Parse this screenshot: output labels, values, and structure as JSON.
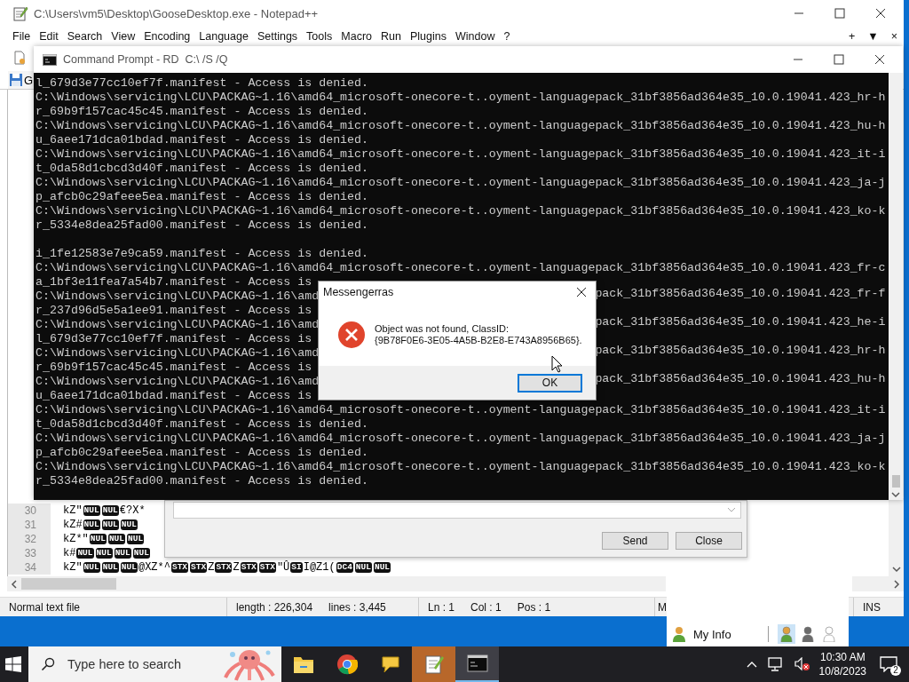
{
  "notepad": {
    "title": "C:\\Users\\vm5\\Desktop\\GooseDesktop.exe - Notepad++",
    "menu": [
      "File",
      "Edit",
      "Search",
      "View",
      "Encoding",
      "Language",
      "Settings",
      "Tools",
      "Macro",
      "Run",
      "Plugins",
      "Window",
      "?"
    ],
    "menu_right": [
      "+",
      "▼",
      "×"
    ],
    "tab": {
      "label": "G"
    },
    "editor": {
      "lines": [
        {
          "number": "30",
          "tokens": [
            {
              "kind": "text",
              "text": "kZ\""
            },
            {
              "kind": "control",
              "text": "NUL"
            },
            {
              "kind": "control",
              "text": "NUL"
            },
            {
              "kind": "text",
              "text": "€?X*"
            }
          ]
        },
        {
          "number": "31",
          "tokens": [
            {
              "kind": "text",
              "text": "kZ#"
            },
            {
              "kind": "control",
              "text": "NUL"
            },
            {
              "kind": "control",
              "text": "NUL"
            },
            {
              "kind": "control",
              "text": "NUL"
            }
          ]
        },
        {
          "number": "32",
          "tokens": [
            {
              "kind": "text",
              "text": "kZ*\""
            },
            {
              "kind": "control",
              "text": "NUL"
            },
            {
              "kind": "control",
              "text": "NUL"
            },
            {
              "kind": "control",
              "text": "NUL"
            }
          ]
        },
        {
          "number": "33",
          "tokens": [
            {
              "kind": "text",
              "text": "k#"
            },
            {
              "kind": "control",
              "text": "NUL"
            },
            {
              "kind": "control",
              "text": "NUL"
            },
            {
              "kind": "control",
              "text": "NUL"
            },
            {
              "kind": "control",
              "text": "NUL"
            }
          ]
        },
        {
          "number": "34",
          "tokens": [
            {
              "kind": "text",
              "text": "kZ\""
            },
            {
              "kind": "control",
              "text": "NUL"
            },
            {
              "kind": "control",
              "text": "NUL"
            },
            {
              "kind": "control",
              "text": "NUL"
            },
            {
              "kind": "text",
              "text": "@XZ*^"
            },
            {
              "kind": "control",
              "text": "STX"
            },
            {
              "kind": "control",
              "text": "STX"
            },
            {
              "kind": "text",
              "text": "Z"
            },
            {
              "kind": "control",
              "text": "STX"
            },
            {
              "kind": "text",
              "text": "Z"
            },
            {
              "kind": "control",
              "text": "STX"
            },
            {
              "kind": "control",
              "text": "STX"
            },
            {
              "kind": "text",
              "text": "\"Û"
            },
            {
              "kind": "control",
              "text": "SI"
            },
            {
              "kind": "text",
              "text": "I@Z1("
            },
            {
              "kind": "control",
              "text": "DC4"
            },
            {
              "kind": "control",
              "text": "NUL"
            },
            {
              "kind": "control",
              "text": "NUL"
            }
          ]
        }
      ]
    },
    "status_bar": [
      {
        "items": [
          "Normal text file"
        ]
      },
      {
        "items": [
          "length : 226,304",
          "lines : 3,445"
        ]
      },
      {
        "items": [
          "Ln : 1",
          "Col : 1",
          "Pos : 1"
        ]
      },
      {
        "items": [
          "M"
        ]
      },
      {
        "items": [
          "INS"
        ]
      }
    ]
  },
  "command_prompt": {
    "title": "Command Prompt - RD  C:\\ /S /Q",
    "lines": [
      {
        "kind": "full",
        "text": "l_679d3e77cc10ef7f.manifest - Access is denied."
      },
      {
        "kind": "full",
        "text": "C:\\Windows\\servicing\\LCU\\PACKAG~1.16\\amd64_microsoft-onecore-t..oyment-languagepack_31bf3856ad364e35_10.0.19041.423_hr-h"
      },
      {
        "kind": "full",
        "text": "r_69b9f157cac45c45.manifest - Access is denied."
      },
      {
        "kind": "full",
        "text": "C:\\Windows\\servicing\\LCU\\PACKAG~1.16\\amd64_microsoft-onecore-t..oyment-languagepack_31bf3856ad364e35_10.0.19041.423_hu-h"
      },
      {
        "kind": "full",
        "text": "u_6aee171dca01bdad.manifest - Access is denied."
      },
      {
        "kind": "full",
        "text": "C:\\Windows\\servicing\\LCU\\PACKAG~1.16\\amd64_microsoft-onecore-t..oyment-languagepack_31bf3856ad364e35_10.0.19041.423_it-i"
      },
      {
        "kind": "full",
        "text": "t_0da58d1cbcd3d40f.manifest - Access is denied."
      },
      {
        "kind": "full",
        "text": "C:\\Windows\\servicing\\LCU\\PACKAG~1.16\\amd64_microsoft-onecore-t..oyment-languagepack_31bf3856ad364e35_10.0.19041.423_ja-j"
      },
      {
        "kind": "full",
        "text": "p_afcb0c29afeee5ea.manifest - Access is denied."
      },
      {
        "kind": "full",
        "text": "C:\\Windows\\servicing\\LCU\\PACKAG~1.16\\amd64_microsoft-onecore-t..oyment-languagepack_31bf3856ad364e35_10.0.19041.423_ko-k"
      },
      {
        "kind": "full",
        "text": "r_5334e8dea25fad00.manifest - Access is denied."
      },
      {
        "kind": "blank"
      },
      {
        "kind": "full",
        "text": "i_1fe12583e7e9ca59.manifest - Access is denied."
      },
      {
        "kind": "full",
        "text": "C:\\Windows\\servicing\\LCU\\PACKAG~1.16\\amd64_microsoft-onecore-t..oyment-languagepack_31bf3856ad364e35_10.0.19041.423_fr-c"
      },
      {
        "kind": "split",
        "left": "a_1bf3e11fea7a54b7.manifest - Access is"
      },
      {
        "kind": "split",
        "left": "C:\\Windows\\servicing\\LCU\\PACKAG~1.16\\amd",
        "right": "pack_31bf3856ad364e35_10.0.19041.423_fr-f"
      },
      {
        "kind": "split",
        "left": "r_237d96d5e5a1ee91.manifest - Access is"
      },
      {
        "kind": "split",
        "left": "C:\\Windows\\servicing\\LCU\\PACKAG~1.16\\amd",
        "right": "pack_31bf3856ad364e35_10.0.19041.423_he-i"
      },
      {
        "kind": "split",
        "left": "l_679d3e77cc10ef7f.manifest - Access is"
      },
      {
        "kind": "split",
        "left": "C:\\Windows\\servicing\\LCU\\PACKAG~1.16\\amd",
        "right": "pack_31bf3856ad364e35_10.0.19041.423_hr-h"
      },
      {
        "kind": "split",
        "left": "r_69b9f157cac45c45.manifest - Access is"
      },
      {
        "kind": "split",
        "left": "C:\\Windows\\servicing\\LCU\\PACKAG~1.16\\amd",
        "right": "pack_31bf3856ad364e35_10.0.19041.423_hu-h"
      },
      {
        "kind": "split",
        "left": "u_6aee171dca01bdad.manifest - Access is"
      },
      {
        "kind": "full",
        "text": "C:\\Windows\\servicing\\LCU\\PACKAG~1.16\\amd64_microsoft-onecore-t..oyment-languagepack_31bf3856ad364e35_10.0.19041.423_it-i"
      },
      {
        "kind": "full",
        "text": "t_0da58d1cbcd3d40f.manifest - Access is denied."
      },
      {
        "kind": "full",
        "text": "C:\\Windows\\servicing\\LCU\\PACKAG~1.16\\amd64_microsoft-onecore-t..oyment-languagepack_31bf3856ad364e35_10.0.19041.423_ja-j"
      },
      {
        "kind": "full",
        "text": "p_afcb0c29afeee5ea.manifest - Access is denied."
      },
      {
        "kind": "full",
        "text": "C:\\Windows\\servicing\\LCU\\PACKAG~1.16\\amd64_microsoft-onecore-t..oyment-languagepack_31bf3856ad364e35_10.0.19041.423_ko-k"
      },
      {
        "kind": "full",
        "text": "r_5334e8dea25fad00.manifest - Access is denied."
      }
    ]
  },
  "messenger": {
    "buttons": [
      "Send",
      "Close"
    ]
  },
  "contact_panel": {
    "my_info": "My Info",
    "statuses": [
      {
        "kind": "online",
        "selected": true
      },
      {
        "kind": "busy",
        "selected": false
      },
      {
        "kind": "offline",
        "selected": false
      }
    ]
  },
  "dialog": {
    "title": "Messengerras",
    "message": "Object was not found, ClassID:\n{9B78F0E6-3E05-4A5B-B2E8-E743A8956B65}.",
    "button": "OK"
  },
  "taskbar": {
    "search_placeholder": "Type here to search",
    "apps": [
      {
        "kind": "folder",
        "flashing": false,
        "active": false
      },
      {
        "kind": "browser",
        "flashing": false,
        "active": false
      },
      {
        "kind": "chat",
        "flashing": false,
        "active": false
      },
      {
        "kind": "notepad",
        "flashing": true,
        "active": false
      },
      {
        "kind": "console",
        "flashing": false,
        "active": true
      }
    ],
    "time": "10:30 AM",
    "date": "10/8/2023",
    "notifications": "2"
  }
}
